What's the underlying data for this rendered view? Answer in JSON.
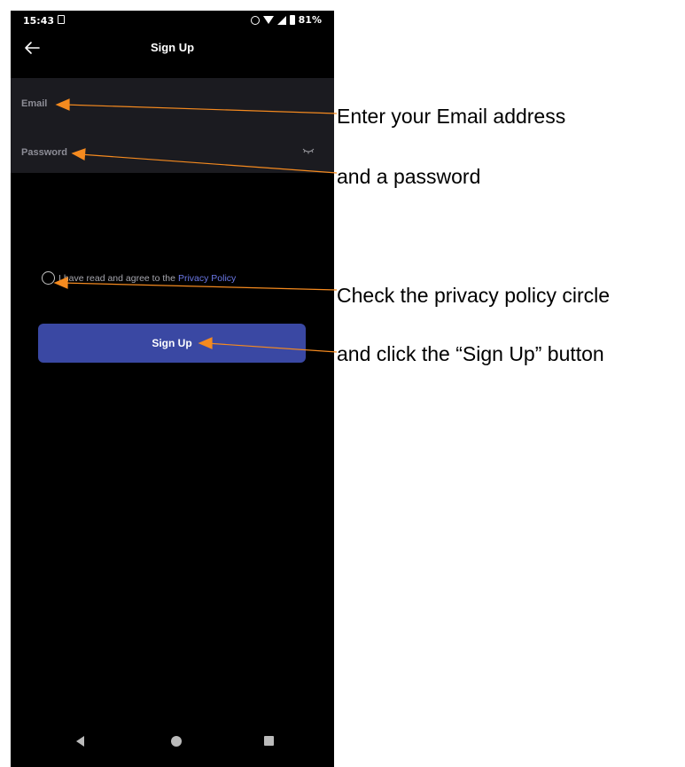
{
  "status_bar": {
    "time": "15:43",
    "battery": "81%"
  },
  "app_bar": {
    "title": "Sign Up"
  },
  "form": {
    "email_placeholder": "Email",
    "password_placeholder": "Password"
  },
  "agreement": {
    "text": "I have read and agree to the",
    "link": "Privacy Policy"
  },
  "signup_button": {
    "label": "Sign Up"
  },
  "annotations": {
    "step_1": "Enter your Email address",
    "step_2": "and a password",
    "step_3": "Check the privacy policy circle",
    "step_4": "and click the “Sign Up” button"
  },
  "colors": {
    "background": "#000000",
    "form_panel": "#1b1b20",
    "button": "#3a48a3",
    "link": "#6b78e6",
    "arrow": "#f58a1f"
  },
  "icons": {
    "back": "arrow-left-icon",
    "eye": "eye-closed-icon",
    "radio": "radio-circle-icon",
    "nav_back": "triangle-back-icon",
    "nav_home": "circle-home-icon",
    "nav_recents": "square-recents-icon"
  }
}
